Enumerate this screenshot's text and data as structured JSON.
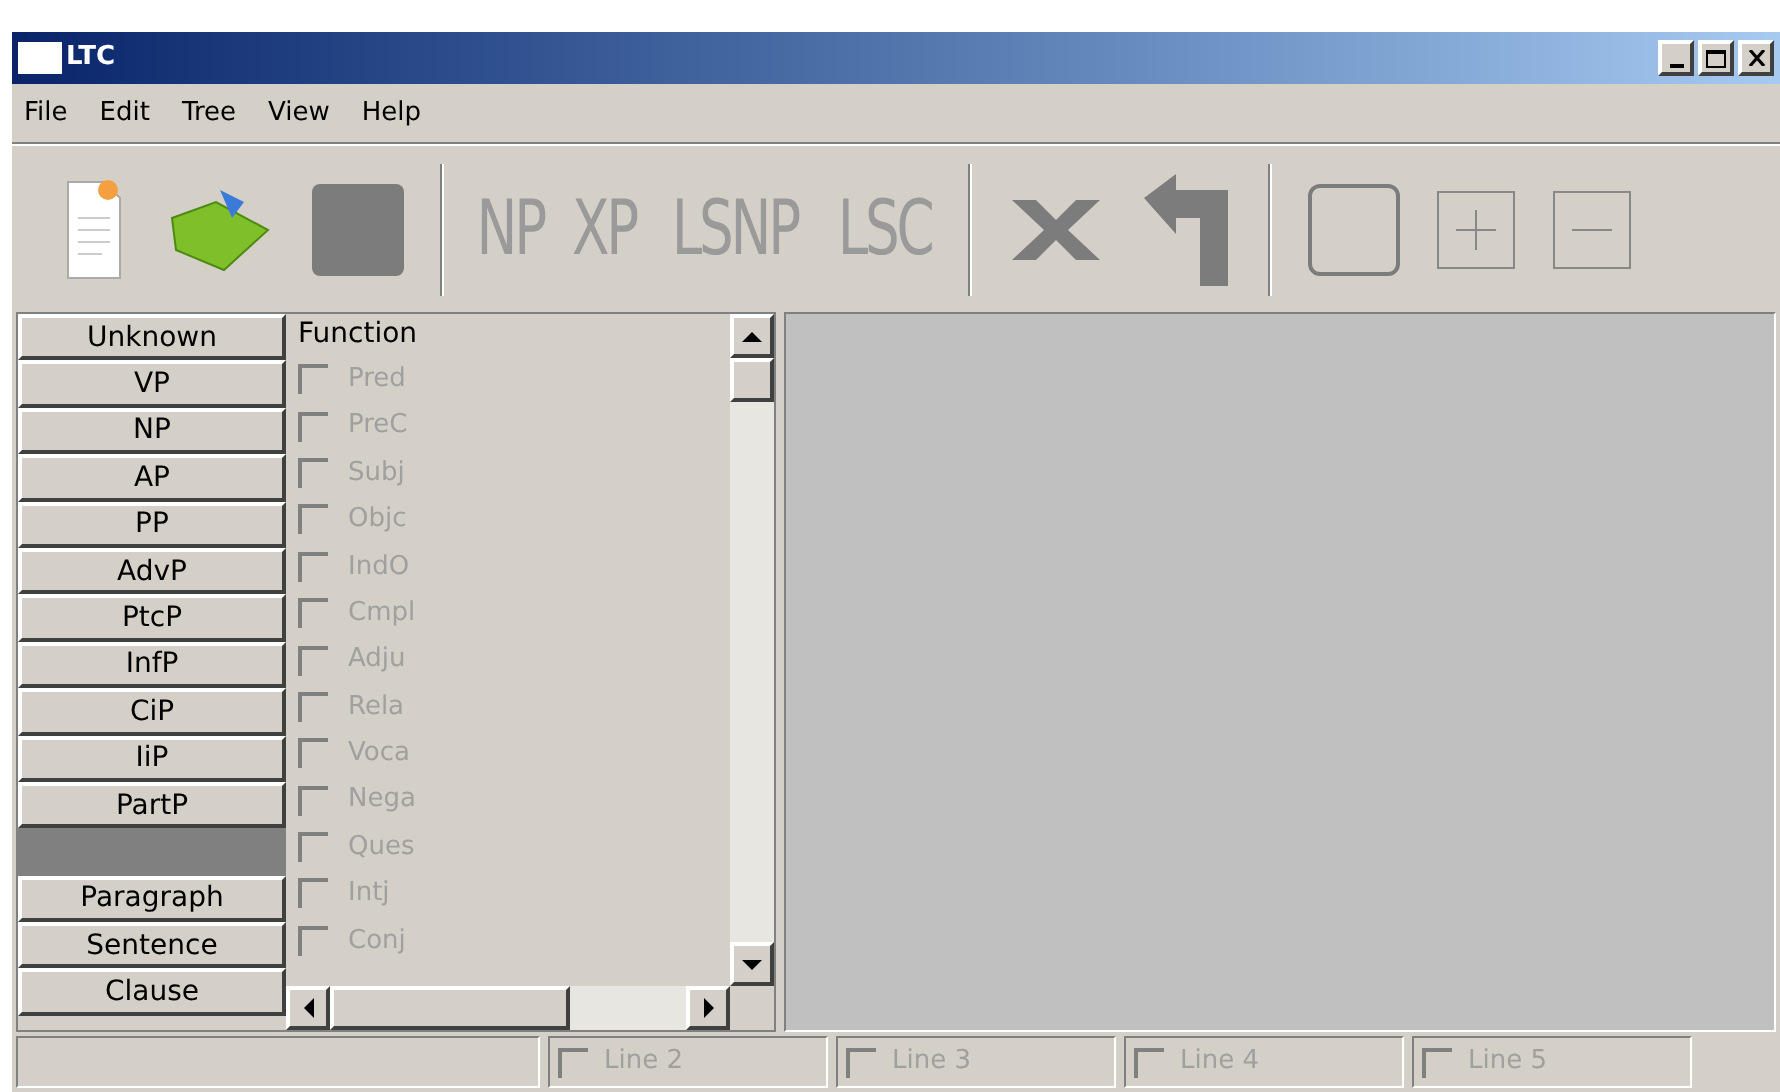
{
  "window": {
    "title": "LTC"
  },
  "menu": [
    "File",
    "Edit",
    "Tree",
    "View",
    "Help"
  ],
  "toolbar": [
    {
      "kind": "new"
    },
    {
      "kind": "open"
    },
    {
      "kind": "square"
    },
    {
      "kind": "sep"
    },
    {
      "kind": "text",
      "label": "NP"
    },
    {
      "kind": "text",
      "label": "XP"
    },
    {
      "kind": "text",
      "label": "LSNP"
    },
    {
      "kind": "text",
      "label": "LSC"
    },
    {
      "kind": "sep"
    },
    {
      "kind": "delete"
    },
    {
      "kind": "return"
    },
    {
      "kind": "sep"
    },
    {
      "kind": "frame"
    },
    {
      "kind": "plus"
    },
    {
      "kind": "minus"
    }
  ],
  "phrase_buttons": [
    {
      "kind": "button",
      "label": "Unknown"
    },
    {
      "kind": "button",
      "label": "VP"
    },
    {
      "kind": "button",
      "label": "NP"
    },
    {
      "kind": "button",
      "label": "AP"
    },
    {
      "kind": "button",
      "label": "PP"
    },
    {
      "kind": "button",
      "label": "AdvP"
    },
    {
      "kind": "button",
      "label": "PtcP"
    },
    {
      "kind": "button",
      "label": "InfP"
    },
    {
      "kind": "button",
      "label": "CiP"
    },
    {
      "kind": "button",
      "label": "IiP"
    },
    {
      "kind": "button",
      "label": "PartP"
    },
    {
      "kind": "blank"
    },
    {
      "kind": "button",
      "label": "Paragraph"
    },
    {
      "kind": "button",
      "label": "Sentence"
    },
    {
      "kind": "button",
      "label": "Clause"
    }
  ],
  "function_list": {
    "heading": "Function",
    "items": [
      {
        "label": "Pred",
        "checked": false,
        "disabled": true
      },
      {
        "label": "PreC",
        "checked": false,
        "disabled": true
      },
      {
        "label": "Subj",
        "checked": false,
        "disabled": true
      },
      {
        "label": "Objc",
        "checked": false,
        "disabled": true
      },
      {
        "label": "IndO",
        "checked": false,
        "disabled": true
      },
      {
        "label": "Cmpl",
        "checked": false,
        "disabled": true
      },
      {
        "label": "Adju",
        "checked": false,
        "disabled": true
      },
      {
        "label": "Rela",
        "checked": false,
        "disabled": true
      },
      {
        "label": "Voca",
        "checked": false,
        "disabled": true
      },
      {
        "label": "Nega",
        "checked": false,
        "disabled": true
      },
      {
        "label": "Ques",
        "checked": false,
        "disabled": true
      },
      {
        "label": "Intj",
        "checked": false,
        "disabled": true
      },
      {
        "label": "Conj",
        "checked": false,
        "disabled": true
      }
    ]
  },
  "status_bar": [
    {
      "label": "Line 2",
      "checked": false,
      "disabled": true
    },
    {
      "label": "Line 3",
      "checked": false,
      "disabled": true
    },
    {
      "label": "Line 4",
      "checked": false,
      "disabled": true
    },
    {
      "label": "Line 5",
      "checked": false,
      "disabled": true
    }
  ]
}
